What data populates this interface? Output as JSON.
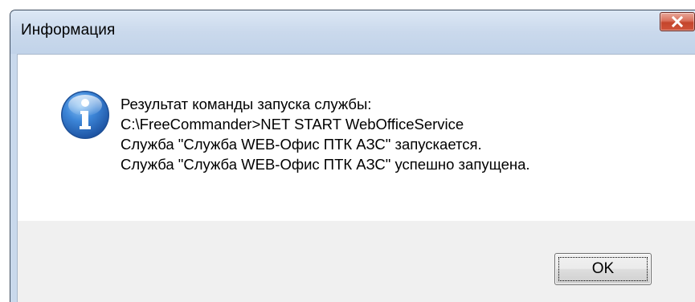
{
  "dialog": {
    "title": "Информация",
    "close_icon": "close-icon",
    "info_icon": "info-icon",
    "message_lines": [
      "Результат команды запуска службы:",
      "C:\\FreeCommander>NET START WebOfficeService",
      "Служба \"Служба WEB-Офис ПТК АЗС\" запускается.",
      "Служба \"Служба WEB-Офис ПТК АЗС\" успешно запущена."
    ],
    "ok_label": "OK"
  },
  "colors": {
    "titlebar": "#c9d9ec",
    "close_button": "#c4452b",
    "info_icon": "#2f6ec0",
    "footer": "#f0f0f0"
  }
}
